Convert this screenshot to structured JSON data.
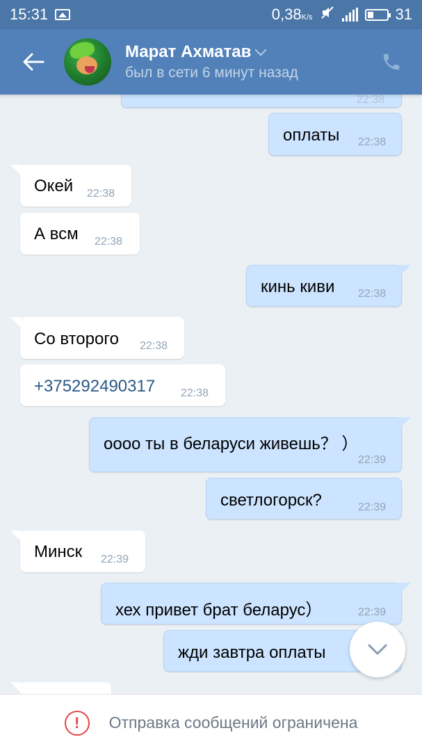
{
  "status_bar": {
    "time": "15:31",
    "network_speed": "0,38",
    "network_unit": "K/s",
    "battery": "31",
    "icons": [
      "image-icon",
      "mute-icon",
      "signal-icon",
      "battery-icon"
    ]
  },
  "header": {
    "contact_name": "Марат Ахматав",
    "last_seen": "был в сети 6 минут назад",
    "icons": [
      "back-arrow-icon",
      "chevron-down-icon",
      "phone-icon"
    ]
  },
  "messages": [
    {
      "dir": "out",
      "text": "",
      "time": "22:38"
    },
    {
      "dir": "out",
      "text": "оплаты",
      "time": "22:38"
    },
    {
      "dir": "in",
      "text": "Окей",
      "time": "22:38"
    },
    {
      "dir": "in",
      "text": "А всм",
      "time": "22:38"
    },
    {
      "dir": "out",
      "text": "кинь киви",
      "time": "22:38"
    },
    {
      "dir": "in",
      "text": "Со второго",
      "time": "22:38"
    },
    {
      "dir": "in",
      "text": "+375292490317",
      "time": "22:38"
    },
    {
      "dir": "out",
      "text": "оооо ты в беларуси живешь？ ）",
      "time": "22:39"
    },
    {
      "dir": "out",
      "text": "светлогорск?",
      "time": "22:39"
    },
    {
      "dir": "in",
      "text": "Минск",
      "time": "22:39"
    },
    {
      "dir": "out",
      "text": "хех привет брат беларус）",
      "time": "22:39"
    },
    {
      "dir": "out",
      "text": "жди завтра оплаты",
      "time": ""
    },
    {
      "dir": "in",
      "text": "",
      "time": ""
    }
  ],
  "scroll_down": {
    "icon": "chevron-down-icon"
  },
  "footer": {
    "warning_symbol": "!",
    "restricted_text": "Отправка сообщений ограничена"
  },
  "colors": {
    "header": "#5181b8",
    "status_bar": "#4a76a8",
    "background": "#ebf0f5",
    "incoming_bubble": "#ffffff",
    "outgoing_bubble": "#cce4ff",
    "link": "#2a5885",
    "warning": "#e64646"
  }
}
